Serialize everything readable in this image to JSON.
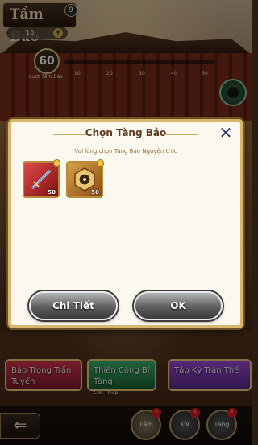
{
  "background": {
    "title": "Tầm Bảo",
    "level_badge": "9",
    "counter": "10",
    "level": "60",
    "level_sub": "Lượt Tầm Bảo",
    "progress_ticks": [
      "10",
      "20",
      "30",
      "40",
      "50"
    ],
    "cards": [
      {
        "label": "Bảo Trọng Trấn Tuyển",
        "sub": ""
      },
      {
        "label": "Thiên Công Bí Tàng",
        "sub": "Cửu Thiệp"
      },
      {
        "label": "Tập Kỳ Trân Thế",
        "sub": ""
      }
    ],
    "back_label": "⇐",
    "tabs": [
      {
        "label": "Tầm Bảo",
        "badge": "!"
      },
      {
        "label": "KN",
        "badge": "!"
      },
      {
        "label": "Tàng Bảo",
        "badge": "!"
      }
    ]
  },
  "modal": {
    "title": "Chọn Tàng Bảo",
    "close_symbol": "✕",
    "subtitle": "Vui lòng chọn Tàng Bảo Nguyện Ước",
    "items": [
      {
        "icon": "sword-icon",
        "quantity": "50",
        "color": "#e04a4a"
      },
      {
        "icon": "compass-icon",
        "quantity": "50",
        "color": "#d6a24a"
      }
    ],
    "detail_button": "Chi Tiết",
    "ok_button": "OK"
  }
}
